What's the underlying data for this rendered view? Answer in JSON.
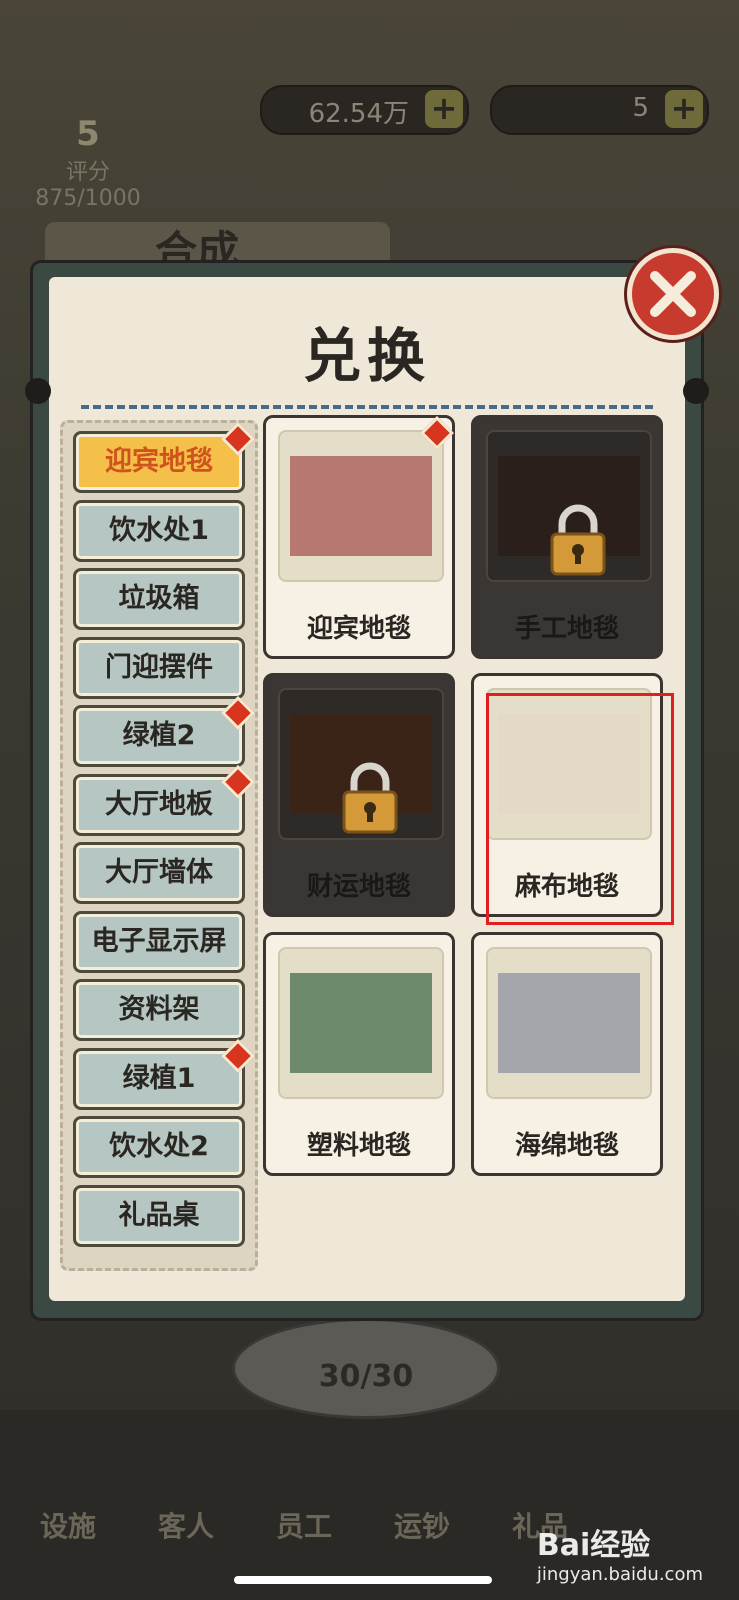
{
  "hud": {
    "cash": "62.54万",
    "gems": "5",
    "rating_value": "5",
    "rating_label": "评分",
    "rating_progress": "875/1000"
  },
  "background_tab": "合成",
  "dialog": {
    "title": "兑换"
  },
  "side_list": [
    {
      "label": "迎宾地毯",
      "active": true,
      "badge": true
    },
    {
      "label": "饮水处1",
      "active": false,
      "badge": false
    },
    {
      "label": "垃圾箱",
      "active": false,
      "badge": false
    },
    {
      "label": "门迎摆件",
      "active": false,
      "badge": false
    },
    {
      "label": "绿植2",
      "active": false,
      "badge": true
    },
    {
      "label": "大厅地板",
      "active": false,
      "badge": true
    },
    {
      "label": "大厅墙体",
      "active": false,
      "badge": false
    },
    {
      "label": "电子显示屏",
      "active": false,
      "badge": false
    },
    {
      "label": "资料架",
      "active": false,
      "badge": false
    },
    {
      "label": "绿植1",
      "active": false,
      "badge": true
    },
    {
      "label": "饮水处2",
      "active": false,
      "badge": false
    },
    {
      "label": "礼品桌",
      "active": false,
      "badge": false
    }
  ],
  "cards": [
    {
      "label": "迎宾地毯",
      "locked": false,
      "color": "#b87872",
      "badge": true
    },
    {
      "label": "手工地毯",
      "locked": true,
      "color": "#2a1f1b",
      "badge": false
    },
    {
      "label": "财运地毯",
      "locked": true,
      "color": "#3a2418",
      "badge": false
    },
    {
      "label": "麻布地毯",
      "locked": false,
      "color": "#e4d9c6",
      "badge": false,
      "highlighted": true
    },
    {
      "label": "塑料地毯",
      "locked": false,
      "color": "#6d8a6c",
      "badge": false
    },
    {
      "label": "海绵地毯",
      "locked": false,
      "color": "#a4a6ab",
      "badge": false
    }
  ],
  "counter": "30/30",
  "bottom_nav": [
    "设施",
    "客人",
    "员工",
    "运钞",
    "礼品"
  ],
  "watermark": {
    "brand": "Bai经验",
    "url": "jingyan.baidu.com"
  },
  "colors": {
    "accent_active": "#f5c04a",
    "badge_red": "#d8351f",
    "close_red": "#c73a2e",
    "highlight_border": "#e02020"
  }
}
